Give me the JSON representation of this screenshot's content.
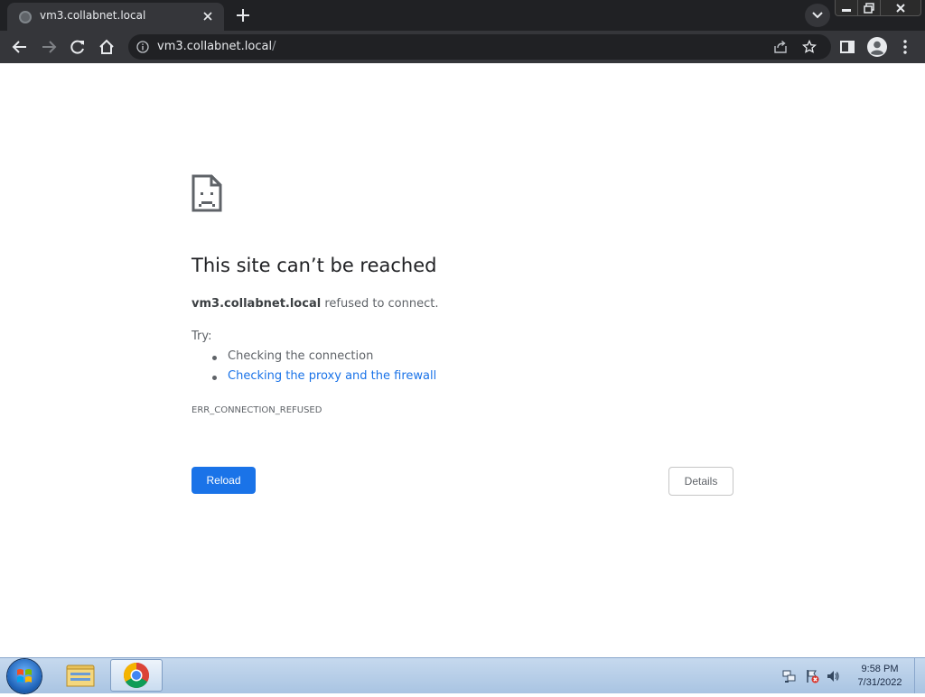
{
  "browser": {
    "tab": {
      "title": "vm3.collabnet.local"
    },
    "address_bar": {
      "host": "vm3.collabnet.local",
      "path": "/"
    }
  },
  "error_page": {
    "title": "This site can’t be reached",
    "host": "vm3.collabnet.local",
    "message": "refused to connect.",
    "try_label": "Try:",
    "suggestions": [
      {
        "label": "Checking the connection",
        "is_link": false
      },
      {
        "label": "Checking the proxy and the firewall",
        "is_link": true
      }
    ],
    "error_code": "ERR_CONNECTION_REFUSED",
    "reload_label": "Reload",
    "details_label": "Details"
  },
  "taskbar": {
    "clock_time": "9:58 PM",
    "clock_date": "7/31/2022",
    "pinned": [
      "windows-explorer",
      "google-chrome"
    ]
  },
  "colors": {
    "accent": "#1a73e8",
    "tabstrip": "#202124",
    "toolbar": "#35363a"
  },
  "icons": [
    "sad-page-icon",
    "info-icon",
    "share-icon",
    "star-icon",
    "side-panel-icon",
    "profile-icon",
    "kebab-menu-icon"
  ]
}
